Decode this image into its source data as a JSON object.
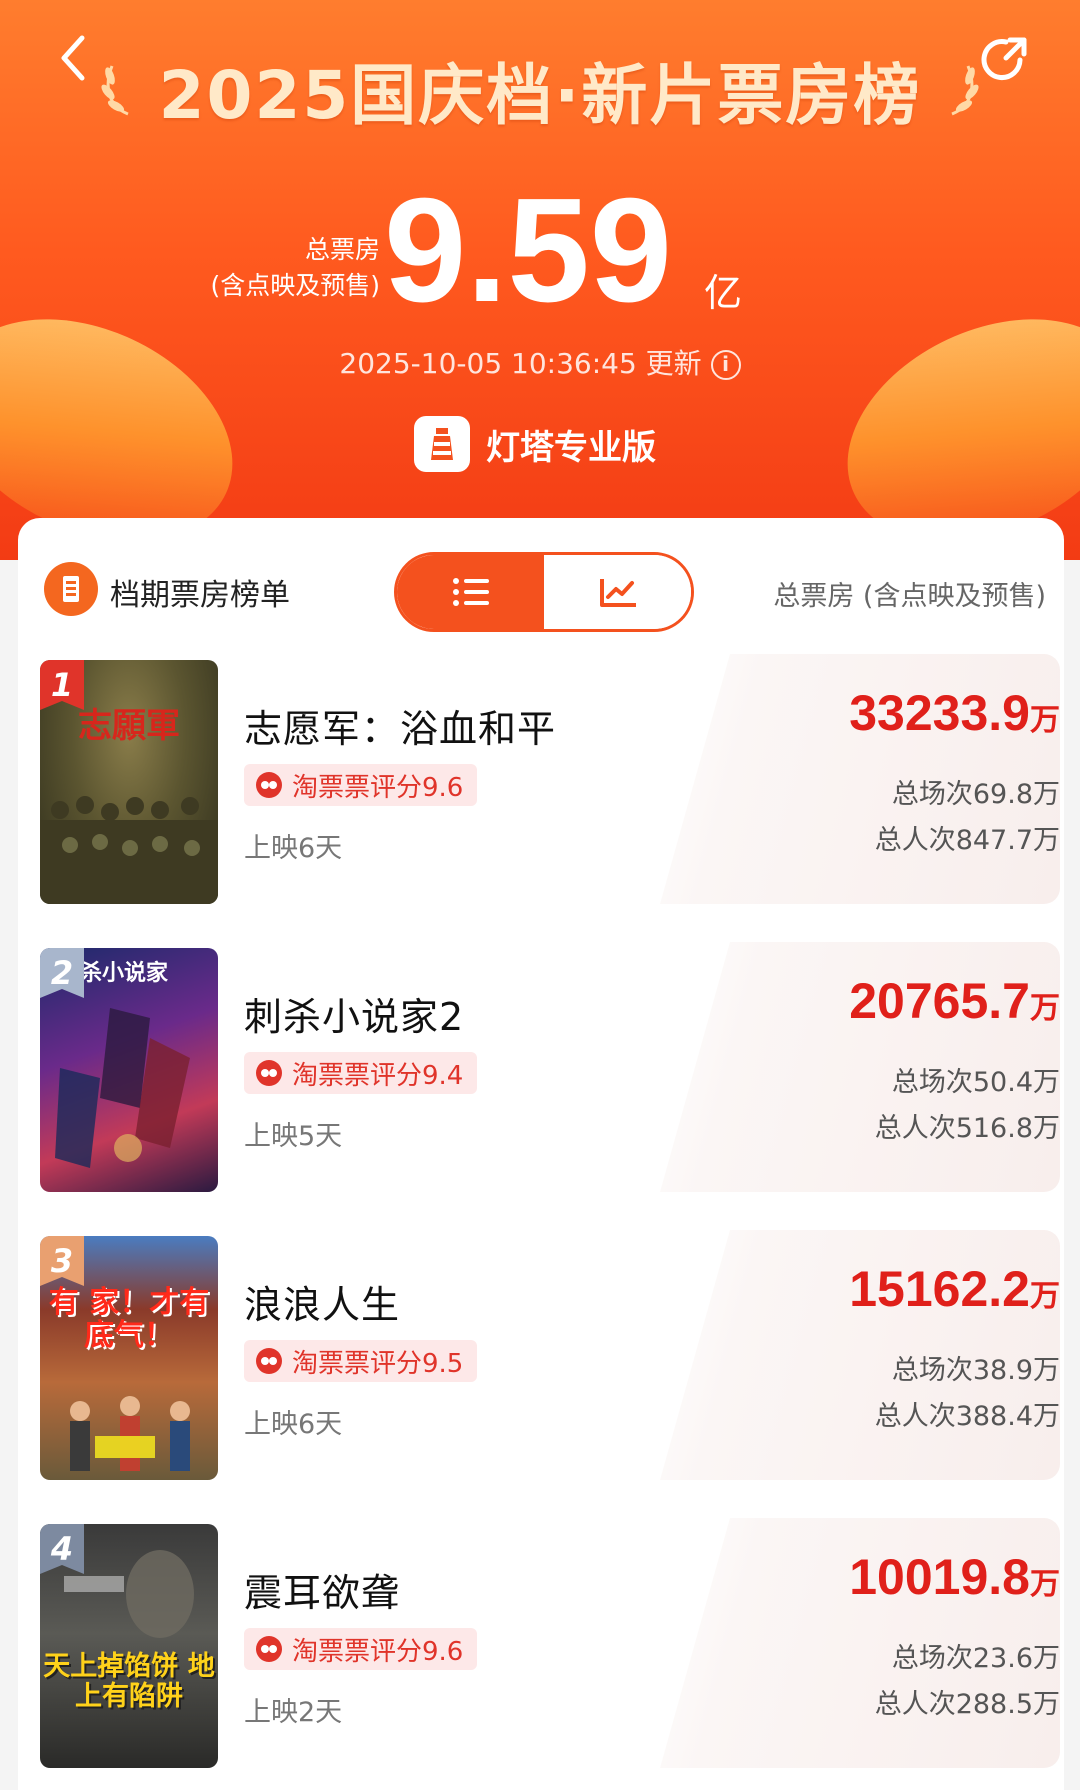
{
  "header": {
    "back_icon": "chevron-left-icon",
    "share_icon": "share-icon",
    "title": "2025国庆档·新片票房榜",
    "total_label_line1": "总票房",
    "total_label_line2": "(含点映及预售)",
    "total_value": "9.59",
    "total_unit": "亿",
    "update_time": "2025-10-05 10:36:45 更新",
    "brand_name": "灯塔专业版"
  },
  "panel": {
    "list_title": "档期票房榜单",
    "column_header": "总票房 (含点映及预售)",
    "toggle": {
      "active": "list",
      "list_icon": "list-icon",
      "chart_icon": "trend-chart-icon"
    },
    "colors": {
      "accent": "#f4511e",
      "value_red": "#e0201a",
      "rating_bg": "#fde8e8"
    }
  },
  "movies": [
    {
      "rank": "1",
      "title": "志愿军：浴血和平",
      "rating": "淘票票评分9.6",
      "days": "上映6天",
      "box_value": "33233.9",
      "box_unit": "万",
      "screenings": "总场次69.8万",
      "admissions": "总人次847.7万",
      "poster_text": "志願軍",
      "badge_color": "#e0342a"
    },
    {
      "rank": "2",
      "title": "刺杀小说家2",
      "rating": "淘票票评分9.4",
      "days": "上映5天",
      "box_value": "20765.7",
      "box_unit": "万",
      "screenings": "总场次50.4万",
      "admissions": "总人次516.8万",
      "poster_text": "刺杀小说家",
      "badge_color": "#a8b6cc"
    },
    {
      "rank": "3",
      "title": "浪浪人生",
      "rating": "淘票票评分9.5",
      "days": "上映6天",
      "box_value": "15162.2",
      "box_unit": "万",
      "screenings": "总场次38.9万",
      "admissions": "总人次388.4万",
      "poster_text": "有 家！才有底气！",
      "badge_color": "#e9a070"
    },
    {
      "rank": "4",
      "title": "震耳欲聋",
      "rating": "淘票票评分9.6",
      "days": "上映2天",
      "box_value": "10019.8",
      "box_unit": "万",
      "screenings": "总场次23.6万",
      "admissions": "总人次288.5万",
      "poster_text": "天上掉馅饼 地上有陷阱",
      "badge_color": "#7d8aa0"
    }
  ]
}
